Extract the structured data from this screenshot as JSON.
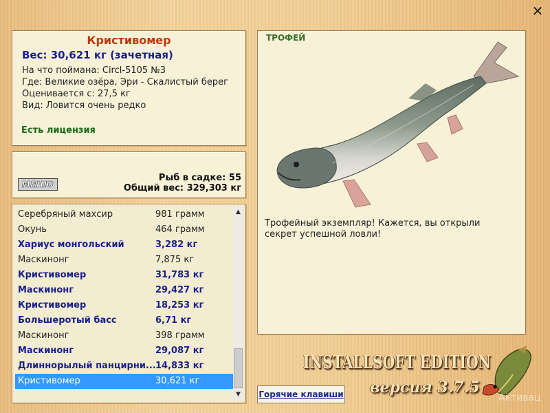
{
  "window": {
    "close_icon": "close-icon"
  },
  "fish_info": {
    "name": "Кристивомер",
    "weight_line": "Вес: 30,621 кг (зачетная)",
    "caught_with": "На что поймана: Circl-5105 №3",
    "caught_where": "Где: Великие озёра, Эри - Скалистый берег",
    "estimate": "Оценивается с: 27,5 кг",
    "kind": "Вид: Ловится очень редко",
    "license": "Есть лицензия"
  },
  "cage": {
    "menu_label": "МЕНЮ",
    "count": "Рыб в садке: 55",
    "total_weight": "Общий вес: 329,303 кг"
  },
  "catch_list": [
    {
      "name": "Серебряный махсир",
      "weight": "981 грамм",
      "trophy": false,
      "selected": false
    },
    {
      "name": "Окунь",
      "weight": "464 грамм",
      "trophy": false,
      "selected": false
    },
    {
      "name": "Хариус монгольский",
      "weight": "3,282 кг",
      "trophy": true,
      "selected": false
    },
    {
      "name": "Маскинонг",
      "weight": "7,875 кг",
      "trophy": false,
      "selected": false
    },
    {
      "name": "Кристивомер",
      "weight": "31,783 кг",
      "trophy": true,
      "selected": false
    },
    {
      "name": "Маскинонг",
      "weight": "29,427 кг",
      "trophy": true,
      "selected": false
    },
    {
      "name": "Кристивомер",
      "weight": "18,253 кг",
      "trophy": true,
      "selected": false
    },
    {
      "name": "Большеротый басс",
      "weight": "6,71 кг",
      "trophy": true,
      "selected": false
    },
    {
      "name": "Маскинонг",
      "weight": "398 грамм",
      "trophy": false,
      "selected": false
    },
    {
      "name": "Маскинонг",
      "weight": "29,087 кг",
      "trophy": true,
      "selected": false
    },
    {
      "name": "Длиннорылый панцирни...",
      "weight": "14,833 кг",
      "trophy": true,
      "selected": false
    },
    {
      "name": "Кристивомер",
      "weight": "30,621 кг",
      "trophy": false,
      "selected": true
    }
  ],
  "trophy": {
    "label": "ТРОФЕЙ",
    "message": "Трофейный экземпляр! Кажется, вы открыли секрет успешной ловли!",
    "fish_image": "lake-trout-image"
  },
  "hotkeys_label": "Горячие клавиши",
  "branding": {
    "edition": "INSTALLSOFT EDITION",
    "version": "версия 3.7.5",
    "logo": "pike-logo",
    "activate": "Активац"
  },
  "colors": {
    "fish_name": "#c0390b",
    "trophy_text": "#1a1f8c",
    "license": "#1c6b18",
    "selection": "#3399ff",
    "panel_bg": "#f7f1d8"
  }
}
